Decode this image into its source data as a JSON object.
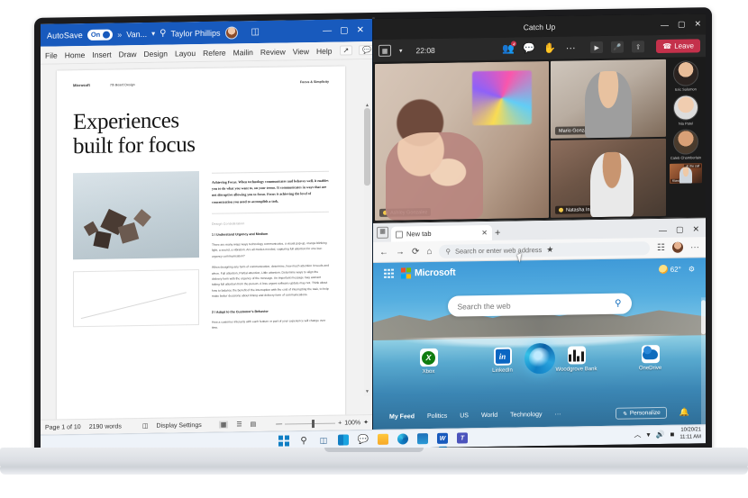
{
  "word": {
    "titlebar": {
      "autosave_label": "AutoSave",
      "autosave_state": "On",
      "more_chevron": "»",
      "doc_name": "Van...",
      "doc_chevron": "▾",
      "search_icon": "search-icon",
      "user_name": "Taylor Phillips",
      "ribbon_display_icon": "ribbon-display-icon",
      "minimize": "—",
      "maximize": "▢",
      "close": "✕"
    },
    "ribbon_tabs": [
      "File",
      "Home",
      "Insert",
      "Draw",
      "Design",
      "Layout",
      "References",
      "Mailings",
      "Review",
      "View",
      "Help"
    ],
    "ribbon_tabs_display": [
      "File",
      "Home",
      "Insert",
      "Draw",
      "Design",
      "Layou",
      "Refere",
      "Mailin",
      "Review",
      "View",
      "Help"
    ],
    "ribbon_right": [
      "share-icon",
      "comments-icon"
    ],
    "document": {
      "header_brand": "Microsoft",
      "header_center": "7th Board Design",
      "header_right": "Focus & Simplicity",
      "title_line1": "Experiences",
      "title_line2": "built for focus",
      "lede": "Achieving Focus. When technology communicates and behaves well, it enables you to do what you want to, on your terms. It communicates in ways that are not disruptive allowing you to focus. Focus is achieving the level of concentration you need to accomplish a task.",
      "section_label": "Design Consideration",
      "heading1": "1 / Understand Urgency and Medium",
      "para1": "There are many ways ways technology communicates, a visual pop-up, orange blinking light, a sound, a vibration. Are all modes needed, capturing full attention for one low-urgency communication?",
      "para2": "When designing any form of communication, determine, how much attention it needs and when. Full attention, Partial attention, Little attention. Determine ways to align the delivery form with the urgency of the message. An important message may warrant taking full attention from the person. A less urgent software update may not. Think about how to balance the benefit of the interruption with the cost of interrupting the task, to help make better decisions about timing and delivery form of communications.",
      "heading2": "2 / Adapt to the Customer's Behavior",
      "para3": "How a customer interacts with each feature or part of your experience will change over time."
    },
    "status": {
      "page_info": "Page 1 of 10",
      "word_count": "2190 words",
      "display_settings": "Display Settings",
      "view_icons": [
        "print-layout-icon",
        "web-layout-icon",
        "read-mode-icon"
      ],
      "zoom_out": "—",
      "zoom_in": "+",
      "zoom_level": "100%",
      "focus_icon": "focus-mode-icon"
    }
  },
  "teams": {
    "title": "Catch Up",
    "window_controls": {
      "minimize": "—",
      "maximize": "▢",
      "close": "✕"
    },
    "toolbar": {
      "grid_icon": "gallery-view-icon",
      "grid_chevron": "▾",
      "timer": "22:08",
      "people_icon": "people-icon",
      "people_badge": "4",
      "chat_icon": "chat-icon",
      "raise_hand_icon": "raise-hand-icon",
      "more_icon": "···",
      "camera_icon": "camera-icon",
      "mic_icon": "microphone-icon",
      "share_icon": "share-screen-icon",
      "leave_label": "Leave",
      "leave_color": "#c4314b"
    },
    "tiles": [
      {
        "name": "Ashley Gonzalez",
        "muted": true
      },
      {
        "name": "Mario Gonzales",
        "muted": false
      },
      {
        "name": "Natasha Innes",
        "muted": true
      }
    ],
    "roster": [
      {
        "name": "Eric Solomon"
      },
      {
        "name": "Nia Patel"
      },
      {
        "name": "Caleb Chamberlain"
      },
      {
        "name": "Kiana Cole",
        "label_right": "In the call"
      }
    ]
  },
  "edge": {
    "tab": {
      "title": "New tab",
      "close": "✕"
    },
    "new_tab_button": "+",
    "window_controls": {
      "minimize": "—",
      "maximize": "▢",
      "close": "✕"
    },
    "nav": {
      "back": "←",
      "forward": "→",
      "refresh": "⟳",
      "home": "⌂",
      "search_icon": "search-icon",
      "address_placeholder": "Search or enter web address",
      "collections_icon": "collections-icon",
      "favorites_icon": "favorites-icon",
      "profile_icon": "profile-avatar",
      "settings_more": "···"
    },
    "newtab": {
      "waffle_icon": "app-launcher-icon",
      "brand": "Microsoft",
      "weather_icon": "partly-sunny-icon",
      "weather_temp": "62°",
      "settings_icon": "page-settings-icon",
      "search_placeholder": "Search the web",
      "search_button_icon": "search-icon",
      "quick_links": [
        {
          "label": "Xbox",
          "icon": "xbox-icon"
        },
        {
          "label": "LinkedIn",
          "icon": "linkedin-icon"
        },
        {
          "label": "Woodgrove Bank",
          "icon": "bank-bars-icon"
        },
        {
          "label": "OneDrive",
          "icon": "onedrive-icon"
        }
      ],
      "feed_nav": [
        "My Feed",
        "Politics",
        "US",
        "World",
        "Technology",
        "···"
      ],
      "personalize_label": "Personalize",
      "personalize_icon": "pencil-icon",
      "notification_icon": "bell-icon"
    }
  },
  "taskbar": {
    "items": [
      {
        "name": "start-button",
        "icon": "windows-logo"
      },
      {
        "name": "search-button",
        "icon": "search-icon"
      },
      {
        "name": "task-view-button",
        "icon": "task-view-icon"
      },
      {
        "name": "widgets-button",
        "icon": "widgets-icon"
      },
      {
        "name": "chat-button",
        "icon": "teams-chat-icon"
      },
      {
        "name": "file-explorer-button",
        "icon": "folder-icon"
      },
      {
        "name": "edge-button",
        "icon": "edge-icon"
      },
      {
        "name": "store-button",
        "icon": "store-icon"
      },
      {
        "name": "word-button",
        "icon": "word-icon"
      },
      {
        "name": "teams-button",
        "icon": "teams-icon"
      }
    ],
    "tray": {
      "chevron": "︿",
      "network_icon": "wifi-icon",
      "volume_icon": "volume-icon",
      "battery_icon": "battery-icon",
      "date": "10/20/21",
      "time": "11:11 AM"
    }
  }
}
